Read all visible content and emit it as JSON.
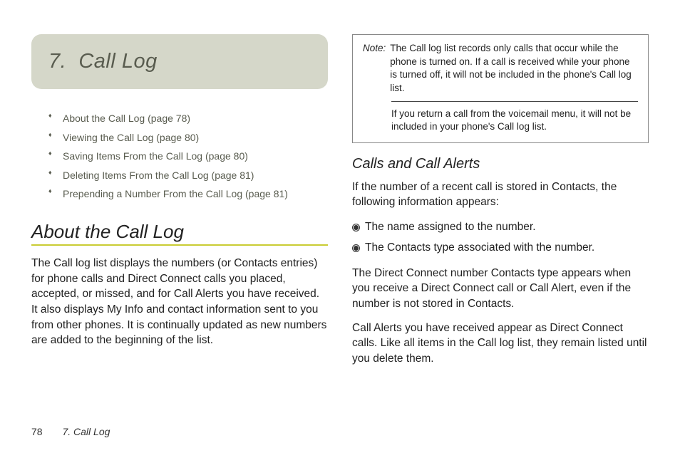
{
  "chapter": {
    "number": "7.",
    "title": "Call Log"
  },
  "toc": [
    "About the Call Log (page 78)",
    "Viewing the Call Log (page 80)",
    "Saving Items From the Call Log (page 80)",
    "Deleting Items From the Call Log (page 81)",
    "Prepending a Number From the Call Log (page 81)"
  ],
  "section1": {
    "heading": "About the Call Log",
    "para": "The Call log list displays the numbers (or Contacts entries) for phone calls and Direct Connect calls you placed, accepted, or missed, and for Call Alerts you have received. It also displays My Info and contact information sent to you from other phones. It is continually updated as new numbers are added to the beginning of the list."
  },
  "note": {
    "label": "Note:",
    "p1": "The Call log list records only calls that occur while the phone is turned on. If a call is received while your phone is turned off, it will not be included in the phone's Call log list.",
    "p2": "If you return a call from the voicemail menu, it will not be included in your phone's Call log list."
  },
  "section2": {
    "heading": "Calls and Call Alerts",
    "intro": "If the number of a recent call is stored in Contacts, the following information appears:",
    "bullets": [
      "The name assigned to the number.",
      "The Contacts type associated with the number."
    ],
    "para2": "The Direct Connect number Contacts type appears when you receive a Direct Connect call or Call Alert, even if the number is not stored in Contacts.",
    "para3": "Call Alerts you have received appear as Direct Connect calls. Like all items in the Call log list, they remain listed until you delete them."
  },
  "footer": {
    "page": "78",
    "label": "7. Call Log"
  }
}
